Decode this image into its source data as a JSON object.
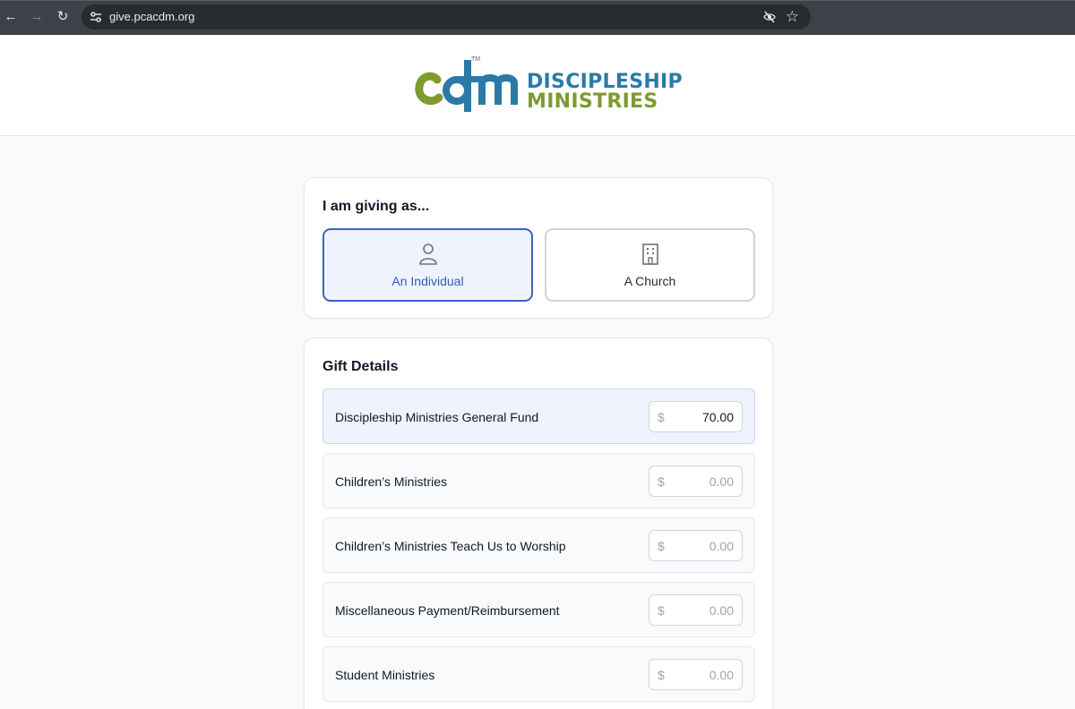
{
  "browser": {
    "url": "give.pcacdm.org",
    "back_icon": "←",
    "forward_icon": "→",
    "reload_icon": "↻",
    "star_icon": "☆"
  },
  "logo": {
    "line1": "DISCIPLESHIP",
    "line2": "MINISTRIES",
    "mark_text": "cdm",
    "tm": "TM",
    "colors": {
      "blue": "#2a7aa8",
      "green": "#7f9a2f"
    }
  },
  "giving_as": {
    "title": "I am giving as...",
    "options": [
      {
        "label": "An Individual",
        "icon": "person-icon",
        "selected": true
      },
      {
        "label": "A Church",
        "icon": "building-icon",
        "selected": false
      }
    ]
  },
  "gift_details": {
    "title": "Gift Details",
    "currency_symbol": "$",
    "placeholder": "0.00",
    "funds": [
      {
        "name": "Discipleship Ministries General Fund",
        "value": "70.00"
      },
      {
        "name": "Children’s Ministries",
        "value": ""
      },
      {
        "name": "Children’s Ministries Teach Us to Worship",
        "value": ""
      },
      {
        "name": "Miscellaneous Payment/Reimbursement",
        "value": ""
      },
      {
        "name": "Student Ministries",
        "value": ""
      }
    ]
  },
  "colors": {
    "accent": "#3b63c4",
    "selected_bg": "#eef3fd",
    "chrome_bg": "#3c4248"
  }
}
